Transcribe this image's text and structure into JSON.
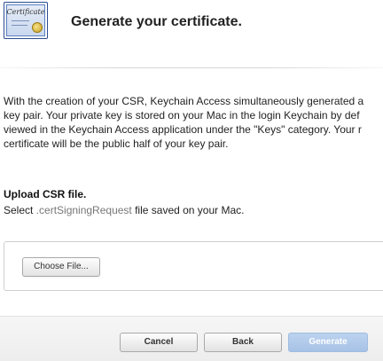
{
  "header": {
    "icon_label": "Certificate",
    "title": "Generate your certificate."
  },
  "description": {
    "lines": [
      "With the creation of your CSR, Keychain Access simultaneously generated a",
      "key pair. Your private key is stored on your Mac in the login Keychain by def",
      "viewed in the Keychain Access application under the \"Keys\" category. Your r",
      "certificate will be the public half of your key pair."
    ]
  },
  "upload": {
    "heading": "Upload CSR file.",
    "desc_prefix": "Select ",
    "desc_ext": ".certSigningRequest",
    "desc_suffix": " file saved on your Mac.",
    "choose_file_label": "Choose File..."
  },
  "footer": {
    "cancel_label": "Cancel",
    "back_label": "Back",
    "generate_label": "Generate"
  }
}
